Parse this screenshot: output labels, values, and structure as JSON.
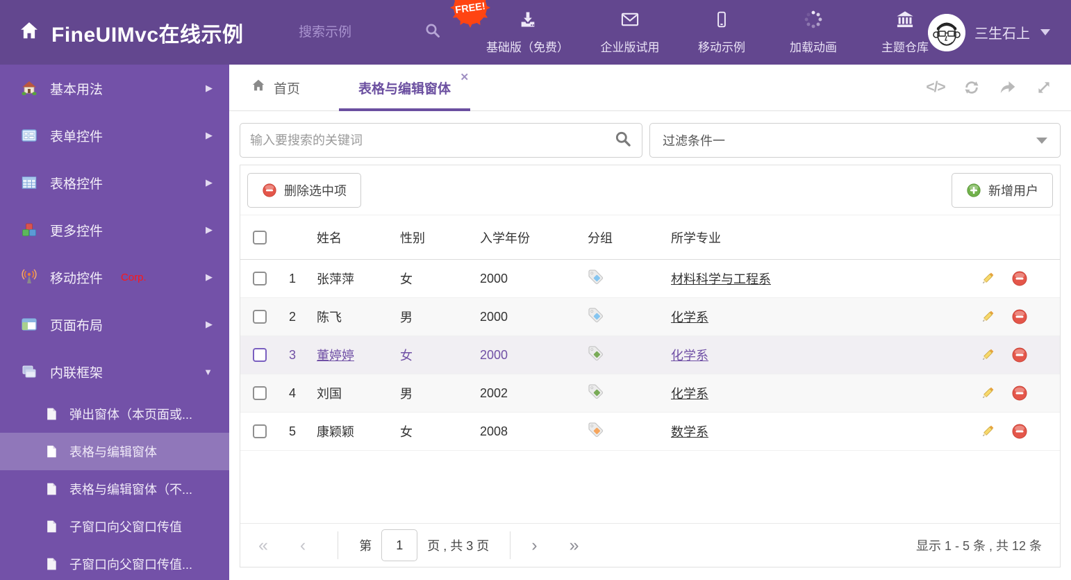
{
  "header": {
    "title": "FineUIMvc在线示例",
    "search_placeholder": "搜索示例",
    "nav": [
      {
        "label": "基础版（免费）",
        "badge": "FREE!"
      },
      {
        "label": "企业版试用"
      },
      {
        "label": "移动示例"
      },
      {
        "label": "加载动画"
      },
      {
        "label": "主题仓库"
      }
    ],
    "user_name": "三生石上"
  },
  "sidebar": {
    "items": [
      {
        "label": "基本用法"
      },
      {
        "label": "表单控件"
      },
      {
        "label": "表格控件"
      },
      {
        "label": "更多控件"
      },
      {
        "label": "移动控件",
        "suffix": "Corp."
      },
      {
        "label": "页面布局"
      },
      {
        "label": "内联框架"
      }
    ],
    "subitems": [
      {
        "label": "弹出窗体（本页面或..."
      },
      {
        "label": "表格与编辑窗体",
        "active": true
      },
      {
        "label": "表格与编辑窗体（不..."
      },
      {
        "label": "子窗口向父窗口传值"
      },
      {
        "label": "子窗口向父窗口传值..."
      }
    ]
  },
  "tabs": {
    "home": "首页",
    "active": "表格与编辑窗体"
  },
  "content": {
    "search_placeholder": "输入要搜索的关键词",
    "filter_value": "过滤条件一",
    "toolbar": {
      "delete_label": "删除选中项",
      "add_label": "新增用户"
    },
    "table": {
      "columns": [
        "姓名",
        "性别",
        "入学年份",
        "分组",
        "所学专业"
      ],
      "rows": [
        {
          "num": "1",
          "name": "张萍萍",
          "gender": "女",
          "year": "2000",
          "tag_color": "#85c5f0",
          "major": "材料科学与工程系",
          "selected": false
        },
        {
          "num": "2",
          "name": "陈飞",
          "gender": "男",
          "year": "2000",
          "tag_color": "#85c5f0",
          "major": "化学系",
          "selected": false
        },
        {
          "num": "3",
          "name": "董婷婷",
          "gender": "女",
          "year": "2000",
          "tag_color": "#79ab57",
          "major": "化学系",
          "selected": true
        },
        {
          "num": "4",
          "name": "刘国",
          "gender": "男",
          "year": "2002",
          "tag_color": "#79ab57",
          "major": "化学系",
          "selected": false
        },
        {
          "num": "5",
          "name": "康颖颖",
          "gender": "女",
          "year": "2008",
          "tag_color": "#f6a55c",
          "major": "数学系",
          "selected": false
        }
      ]
    },
    "pagination": {
      "first": "«",
      "prev": "‹",
      "page_label_before": "第",
      "current_page": "1",
      "page_label_after": "页 , 共 3 页",
      "next": "›",
      "last": "»",
      "summary": "显示 1 - 5 条 , 共 12 条"
    }
  },
  "colors": {
    "header_bg": "#63478f",
    "sidebar_bg": "#7351a8",
    "sidebar_active": "#9077ba",
    "accent_purple": "#6b4fa0",
    "free_badge": "#ff4412",
    "delete_red": "#e4564a",
    "add_green": "#72b24c",
    "tag_blue": "#85c5f0",
    "tag_green": "#79ab57",
    "tag_orange": "#f6a55c"
  }
}
